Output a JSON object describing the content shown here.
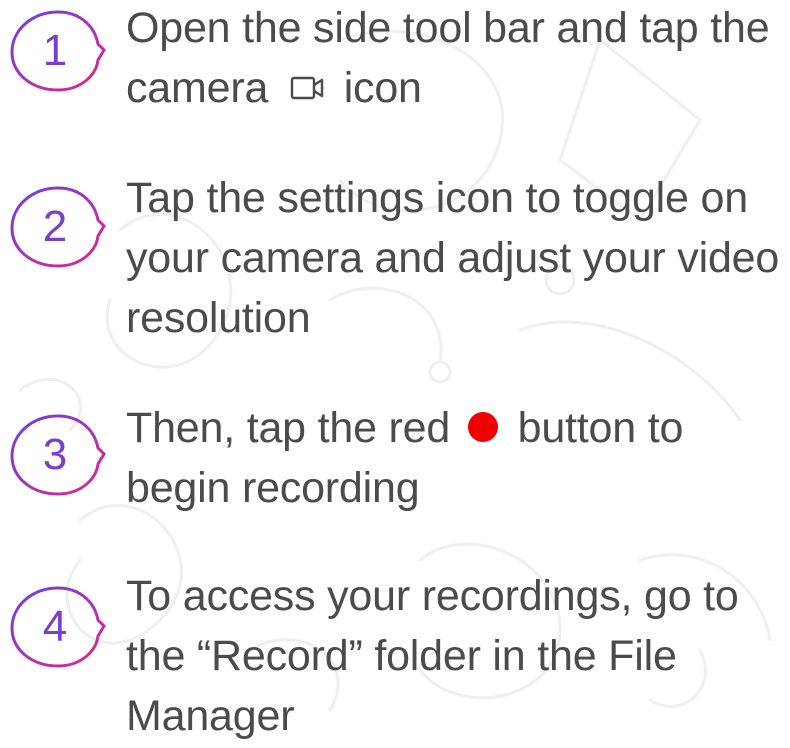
{
  "steps": [
    {
      "number": "1",
      "text_before_icon": "Open the side tool bar and tap the camera",
      "text_after_icon": "icon",
      "inline_icon": "camera-icon"
    },
    {
      "number": "2",
      "text": "Tap the settings icon to toggle on your camera and adjust your video resolution"
    },
    {
      "number": "3",
      "text_before_icon": "Then, tap the red",
      "text_after_icon": "button to begin recording",
      "inline_icon": "red-dot-icon"
    },
    {
      "number": "4",
      "text": "To access your recordings, go to the “Record” folder in the File Manager"
    }
  ],
  "colors": {
    "badge_gradient_start": "#7b3fe0",
    "badge_gradient_end": "#e0288a",
    "text": "#4b4b4b",
    "record_red": "#f00000",
    "doodle_line": "#efefef"
  }
}
